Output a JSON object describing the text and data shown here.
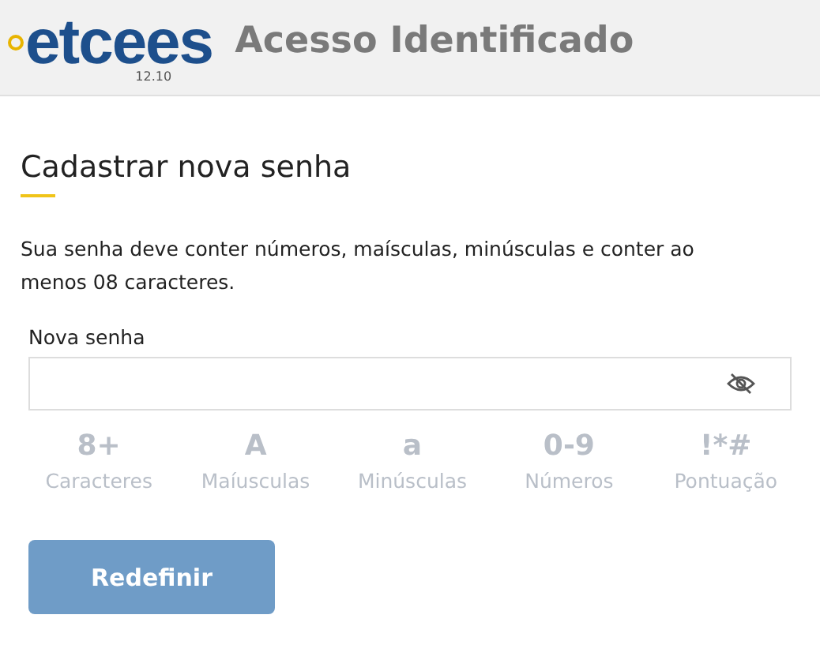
{
  "header": {
    "logo": "etcees",
    "version": "12.10",
    "title": "Acesso Identificado"
  },
  "form": {
    "heading": "Cadastrar nova senha",
    "description": "Sua senha deve conter números, maísculas, minúsculas e conter ao menos 08 caracteres.",
    "field_label": "Nova senha",
    "password_visible": false,
    "requirements": [
      {
        "symbol": "8+",
        "label": "Caracteres",
        "met": false
      },
      {
        "symbol": "A",
        "label": "Maíusculas",
        "met": false
      },
      {
        "symbol": "a",
        "label": "Minúsculas",
        "met": false
      },
      {
        "symbol": "0-9",
        "label": "Números",
        "met": false
      },
      {
        "symbol": "!*#",
        "label": "Pontuação",
        "met": false
      }
    ],
    "submit": {
      "label": "Redefinir",
      "disabled": true
    }
  }
}
